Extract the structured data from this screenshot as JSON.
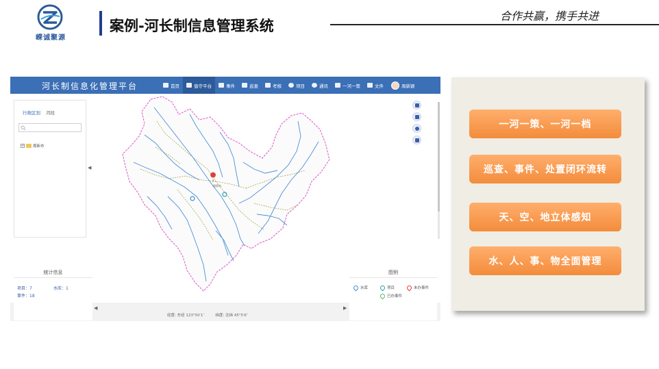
{
  "slide": {
    "brand_name": "嵘诚聚源",
    "title": "案例-河长制信息管理系统",
    "slogan": "合作共赢，携手共进"
  },
  "app": {
    "title": "河长制信息化管理平台",
    "nav": [
      {
        "label": "首页",
        "icon": "home-icon"
      },
      {
        "label": "值守平台",
        "icon": "bar-chart-icon",
        "active": true
      },
      {
        "label": "事件",
        "icon": "network-icon"
      },
      {
        "label": "巡查",
        "icon": "edit-icon"
      },
      {
        "label": "考核",
        "icon": "people-icon"
      },
      {
        "label": "项目",
        "icon": "info-icon"
      },
      {
        "label": "通讯",
        "icon": "chat-icon"
      },
      {
        "label": "一河一策",
        "icon": "document-icon"
      },
      {
        "label": "文件",
        "icon": "image-icon"
      }
    ],
    "user_name": "周新颖",
    "left_panel": {
      "tabs": [
        "行政区划",
        "河段"
      ],
      "tree_root": "周新市"
    },
    "map": {
      "city_label": "周家市"
    },
    "stats": {
      "title": "统计信息",
      "items": [
        {
          "label": "项目：",
          "value": "7"
        },
        {
          "label": "水库：",
          "value": "1"
        },
        {
          "label": "事件：",
          "value": "18"
        }
      ]
    },
    "legend": {
      "title": "图例",
      "items": [
        {
          "label": "水库",
          "color": "#3a8fd8"
        },
        {
          "label": "项目",
          "color": "#2aa0a8"
        },
        {
          "label": "未办事件",
          "color": "#e0403a"
        },
        {
          "label": "已办事件",
          "color": "#5cb85c"
        }
      ]
    },
    "coords": {
      "longitude_label": "经度:",
      "longitude_value": "东经 123°50′1″",
      "latitude_label": "纬度:",
      "latitude_value": "北纬 45°5′6″"
    }
  },
  "features": [
    "一河一策、一河一档",
    "巡查、事件、处置闭环流转",
    "天、空、地立体感知",
    "水、人、事、物全面管理"
  ],
  "colors": {
    "topbar": "#3b6fb6",
    "feature_button": "#f69a4f",
    "card_background": "#efede4",
    "title_accent": "#1f3f8f"
  }
}
